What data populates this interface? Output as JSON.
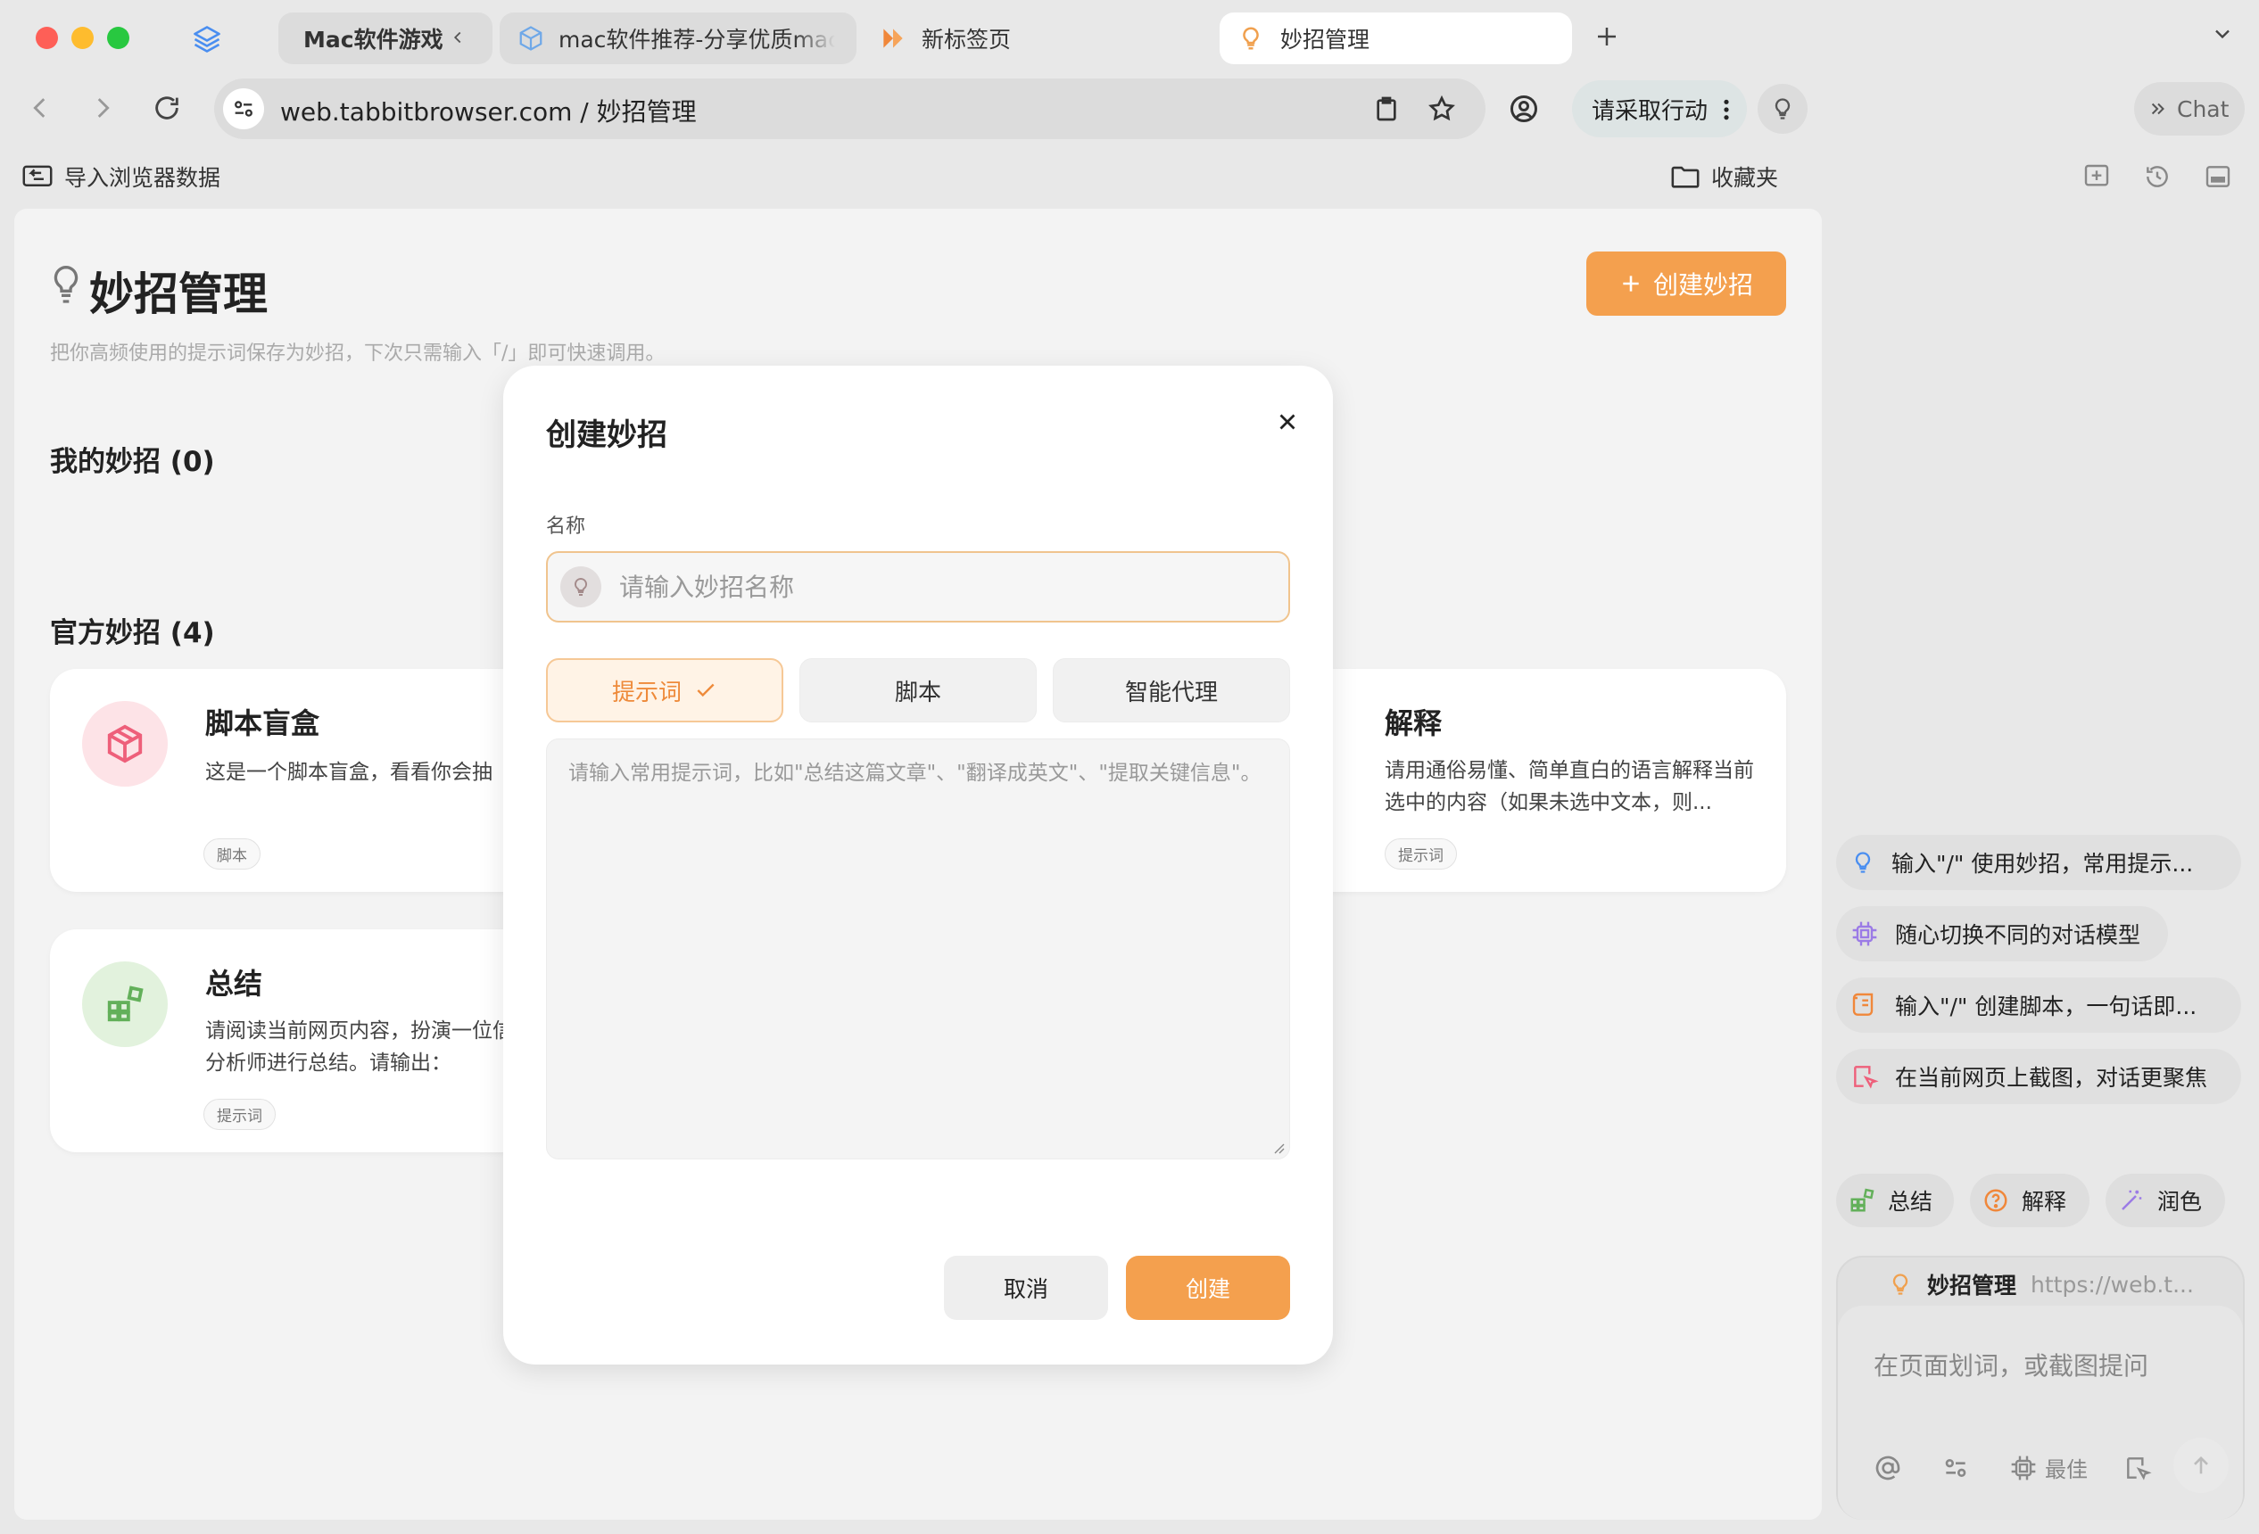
{
  "tabs": {
    "group_label": "Mac软件游戏",
    "tab1_title": "mac软件推荐-分享优质mac软件",
    "tab2_title": "新标签页",
    "active_title": "妙招管理"
  },
  "toolbar": {
    "url": "web.tabbitbrowser.com / 妙招管理",
    "action_label": "请采取行动",
    "chat_label": "Chat"
  },
  "bookmarks": {
    "import_label": "导入浏览器数据",
    "favorites_label": "收藏夹"
  },
  "page": {
    "title": "妙招管理",
    "subtitle": "把你高频使用的提示词保存为妙招，下次只需输入「/」即可快速调用。",
    "create_button": "创建妙招",
    "my_section": "我的妙招 (0)",
    "official_section": "官方妙招 (4)",
    "cards": [
      {
        "title": "脚本盲盒",
        "desc": "这是一个脚本盲盒，看看你会抽",
        "tag": "脚本"
      },
      {
        "title": "解释",
        "desc": "请用通俗易懂、简单直白的语言解释当前选中的内容（如果未选中文本，则...",
        "tag": "提示词"
      },
      {
        "title": "总结",
        "desc": "请阅读当前网页内容，扮演一位信息分析师进行总结。请输出：",
        "tag": "提示词"
      }
    ]
  },
  "modal": {
    "title": "创建妙招",
    "name_label": "名称",
    "name_placeholder": "请输入妙招名称",
    "segments": [
      "提示词",
      "脚本",
      "智能代理"
    ],
    "prompt_placeholder": "请输入常用提示词，比如\"总结这篇文章\"、\"翻译成英文\"、\"提取关键信息\"。",
    "cancel": "取消",
    "create": "创建"
  },
  "sidebar": {
    "suggestions": [
      "输入\"/\" 使用妙招，常用提示...",
      "随心切换不同的对话模型",
      "输入\"/\" 创建脚本，一句话即...",
      "在当前网页上截图，对话更聚焦"
    ],
    "chips": [
      "总结",
      "解释",
      "润色"
    ],
    "context_name": "妙招管理",
    "context_url": "https://web.t...",
    "input_placeholder": "在页面划词，或截图提问",
    "model_label": "最佳"
  },
  "colors": {
    "accent": "#f4a04e",
    "accent_border": "#f0c48e"
  }
}
